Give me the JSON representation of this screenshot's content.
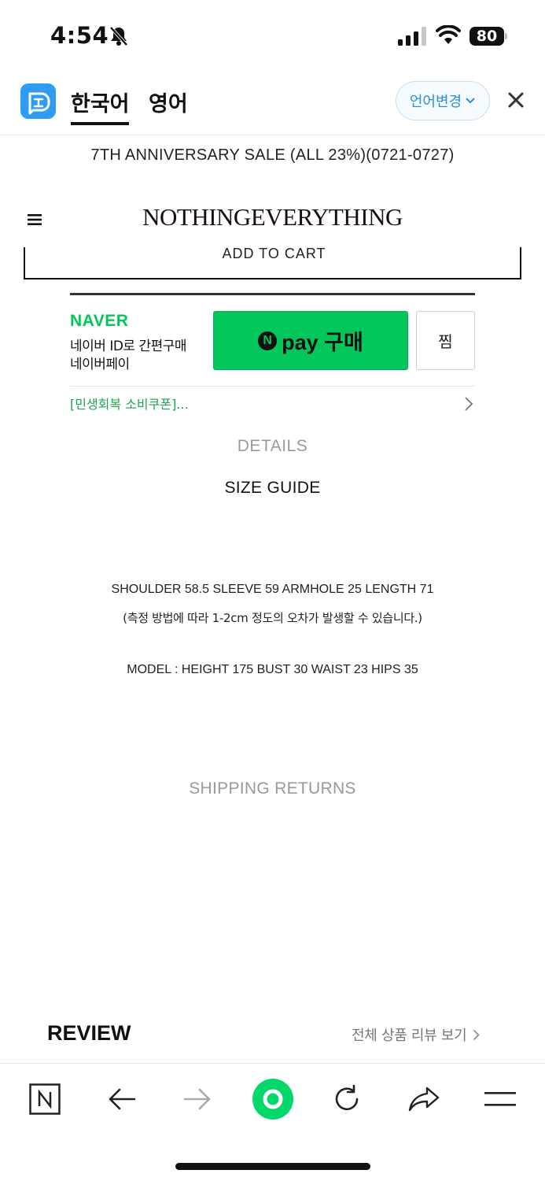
{
  "status_bar": {
    "time": "4:54",
    "battery": "80"
  },
  "translate_bar": {
    "tab_korean": "한국어",
    "tab_english": "영어",
    "change_language": "언어변경"
  },
  "site": {
    "announcement": "7TH ANNIVERSARY SALE (ALL 23%)(0721-0727)",
    "brand": "NOTHINGEVERYTHING",
    "add_to_cart": "ADD TO CART"
  },
  "naver_pay": {
    "brand": "NAVER",
    "line1": "네이버 ID로 간편구매",
    "line2": "네이버페이",
    "pay_button": "pay 구매",
    "pay_n": "N",
    "wish_button": "찜",
    "coupon": "[민생회복 소비쿠폰]..."
  },
  "product_info": {
    "details": "DETAILS",
    "size_guide": "SIZE GUIDE",
    "measurements": "SHOULDER 58.5 SLEEVE 59 ARMHOLE 25 LENGTH 71",
    "note": "(측정 방법에 따라 1-2cm 정도의 오차가 발생할 수 있습니다.)",
    "model": "MODEL : HEIGHT 175 BUST 30 WAIST 23 HIPS 35",
    "shipping": "SHIPPING RETURNS"
  },
  "review": {
    "title": "REVIEW",
    "all_reviews_link": "전체 상품 리뷰 보기"
  },
  "toolbar": {
    "icons": [
      "naver-n-icon",
      "back-arrow-icon",
      "forward-arrow-icon",
      "green-dot-icon",
      "reload-icon",
      "share-icon",
      "menu-icon"
    ]
  },
  "colors": {
    "naver_green": "#03c75a",
    "translate_blue": "#2e9cf2",
    "coupon_green": "#1aa64a"
  }
}
